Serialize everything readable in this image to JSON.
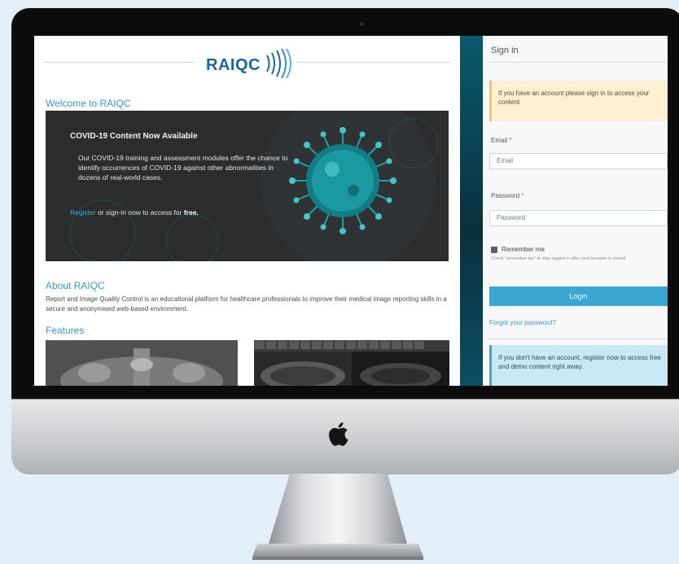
{
  "site": {
    "logo_text": "RAIQC"
  },
  "main": {
    "welcome_heading": "Welcome to RAIQC",
    "covid_banner": {
      "title": "COVID-19 Content Now Available",
      "body": "Our COVID-19 training and assessment modules offer the chance to identify occurrences of COVID-19 against other abnormalities in dozens of real-world cases.",
      "register_link": "Register",
      "cta_middle": " or sign-in now to access for ",
      "cta_bold": "free."
    },
    "about_heading": "About RAIQC",
    "about_body": "Report and Image Quality Control is an educational platform for healthcare professionals to improve their medical image reporting skills in a secure and anonymised web-based environment.",
    "features_heading": "Features"
  },
  "sidebar": {
    "title": "Sign in",
    "warning_alert": "If you have an account please sign in to access your content",
    "email_label": "Email",
    "email_placeholder": "Email",
    "password_label": "Password",
    "password_placeholder": "Password",
    "required_mark": "*",
    "remember_label": "Remember me",
    "remember_help": "Check \"remember me\" to stay logged in after your browser is closed.",
    "login_button": "Login",
    "forgot_link": "Forgot your password?",
    "info_alert": "If you don't have an account, register now to access free and demo content right away."
  },
  "colors": {
    "accent": "#3a9ac4",
    "logo_blue": "#1c63a6",
    "login_button": "#39a6d4",
    "warning_bg": "#fcefd2",
    "info_bg": "#c9e8f6",
    "banner_bg": "#2b2d2f",
    "virus_teal": "#1fa3a8"
  },
  "icons": {
    "logo_waves": "sound-wave-arcs-icon",
    "apple_logo": "apple-logo-icon",
    "virus": "virus-icon"
  }
}
